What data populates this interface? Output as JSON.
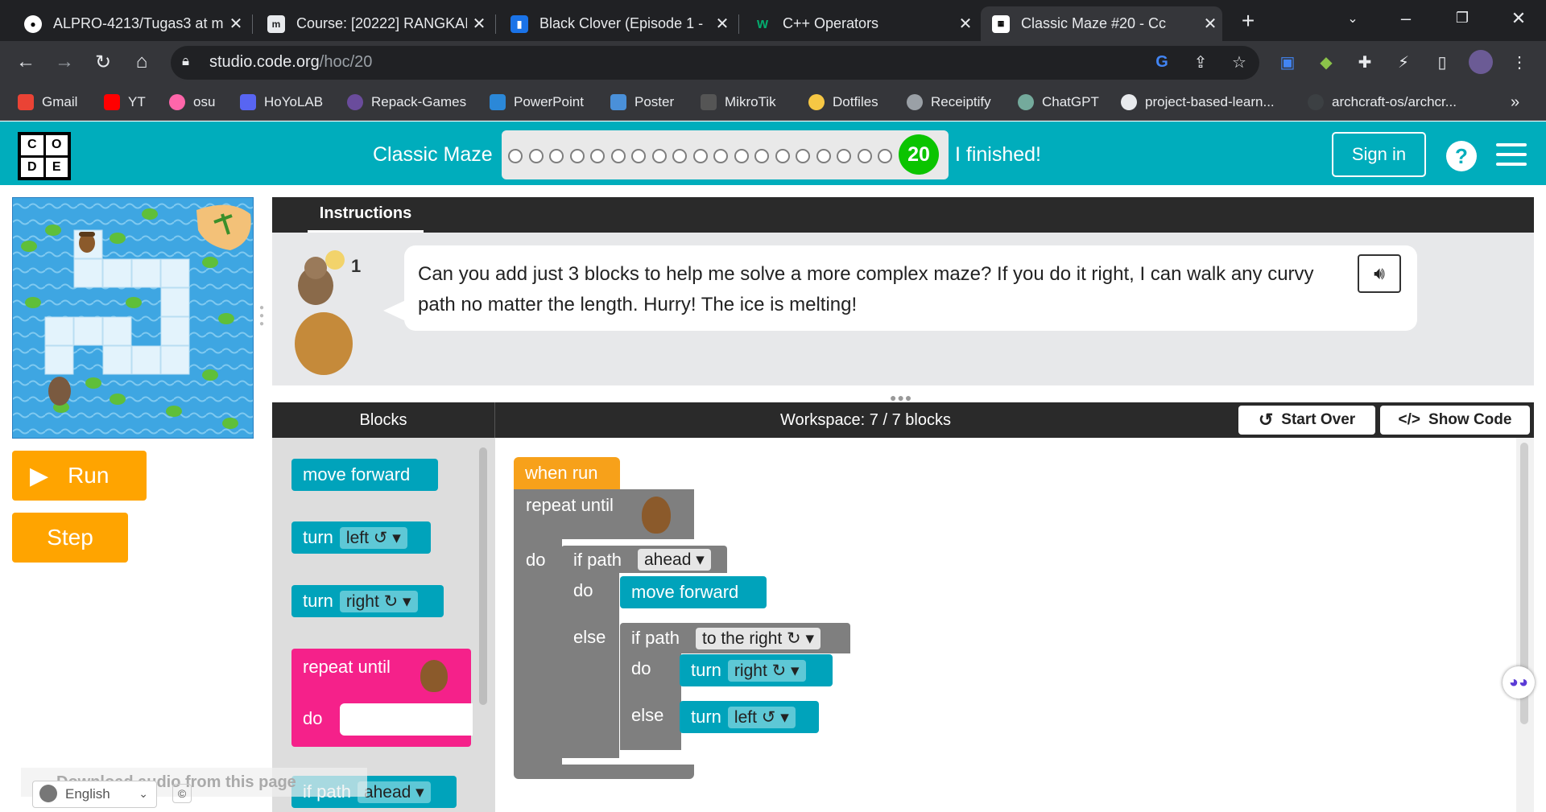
{
  "browser": {
    "tabs": [
      {
        "title": "ALPRO-4213/Tugas3 at m",
        "icon": "github-icon"
      },
      {
        "title": "Course: [20222] RANGKAI",
        "icon": "moodle-icon"
      },
      {
        "title": "Black Clover (Episode 1 -",
        "icon": "bookmark-icon"
      },
      {
        "title": "C++ Operators",
        "icon": "w3schools-icon"
      },
      {
        "title": "Classic Maze #20 - Cc",
        "icon": "code-org-icon"
      }
    ],
    "new_tab": "+",
    "url_host": "studio.code.org",
    "url_path": "/hoc/20",
    "bookmarks": [
      {
        "label": "Gmail"
      },
      {
        "label": "YT"
      },
      {
        "label": "osu"
      },
      {
        "label": "HoYoLAB"
      },
      {
        "label": "Repack-Games"
      },
      {
        "label": "PowerPoint"
      },
      {
        "label": "Poster"
      },
      {
        "label": "MikroTik"
      },
      {
        "label": "Dotfiles"
      },
      {
        "label": "Receiptify"
      },
      {
        "label": "ChatGPT"
      },
      {
        "label": "project-based-learn..."
      },
      {
        "label": "archcraft-os/archcr..."
      }
    ],
    "bookmarks_more": "»"
  },
  "header": {
    "logo_letters": [
      "C",
      "O",
      "D",
      "E"
    ],
    "level_name": "Classic Maze",
    "current_level": "20",
    "finished": "I finished!",
    "sign_in": "Sign in",
    "help": "?"
  },
  "left": {
    "run": "Run",
    "step": "Step"
  },
  "instructions": {
    "tab": "Instructions",
    "text": "Can you add just 3 blocks to help me solve a more complex maze? If you do it right, I can walk any curvy path no matter the length. Hurry! The ice is melting!",
    "hint_count": "1"
  },
  "blocks": {
    "title": "Blocks",
    "workspace_title": "Workspace: 7 / 7 blocks",
    "start_over": "Start Over",
    "show_code": "Show Code",
    "toolbox": {
      "move_forward": "move forward",
      "turn": "turn",
      "left": "left ↺ ▾",
      "right": "right ↻ ▾",
      "repeat_until": "repeat until",
      "do": "do",
      "if_path": "if path",
      "ahead": "ahead ▾"
    },
    "workspace": {
      "when_run": "when run",
      "repeat_until": "repeat until",
      "do": "do",
      "if_path": "if path",
      "ahead": "ahead ▾",
      "move_forward": "move forward",
      "else": "else",
      "to_the_right": "to the right ↻ ▾",
      "turn": "turn",
      "right": "right ↻ ▾",
      "left": "left ↺ ▾"
    }
  },
  "footer": {
    "download_audio": "Download audio from this page",
    "language": "English",
    "copyright": "©"
  }
}
